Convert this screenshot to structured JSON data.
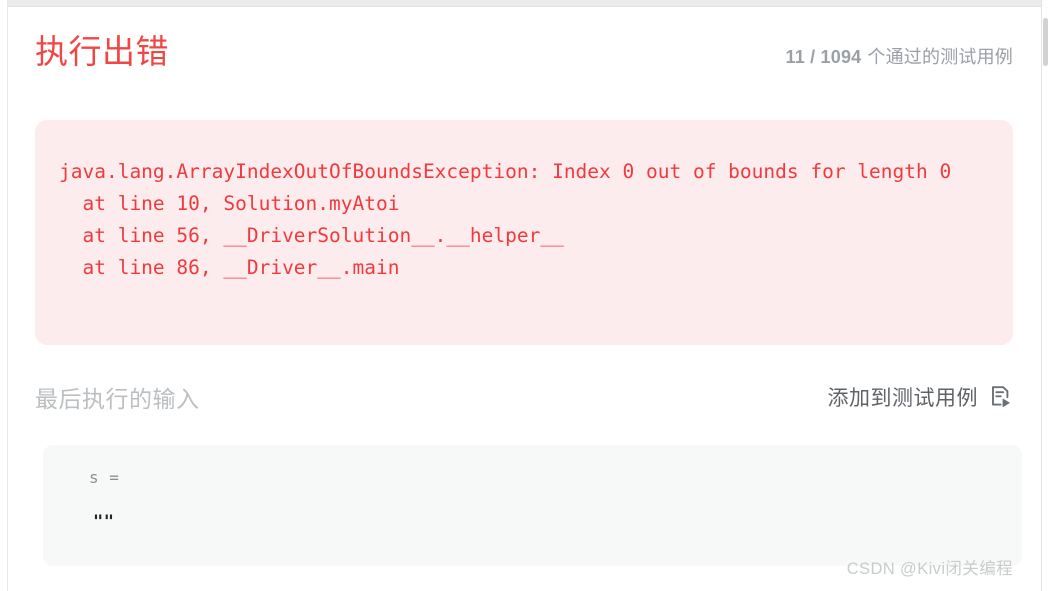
{
  "header": {
    "status_title": "执行出错",
    "testcase_counts": "11 / 1094",
    "testcase_label": "个通过的测试用例"
  },
  "error_panel": {
    "message": "java.lang.ArrayIndexOutOfBoundsException: Index 0 out of bounds for length 0\n  at line 10, Solution.myAtoi\n  at line 56, __DriverSolution__.__helper__\n  at line 86, __Driver__.main",
    "background_color": "#fdeced",
    "text_color": "#f03a3e"
  },
  "last_input": {
    "section_label": "最后执行的输入",
    "add_testcase_label": "添加到测试用例",
    "add_testcase_icon": "testcase-run-icon",
    "variable_name": "s =",
    "variable_value": "\"\""
  },
  "watermark": {
    "text": "CSDN @Kivi闭关编程"
  },
  "theme": {
    "accent_red": "#ef4743",
    "muted_gray": "#9aa0a6"
  }
}
